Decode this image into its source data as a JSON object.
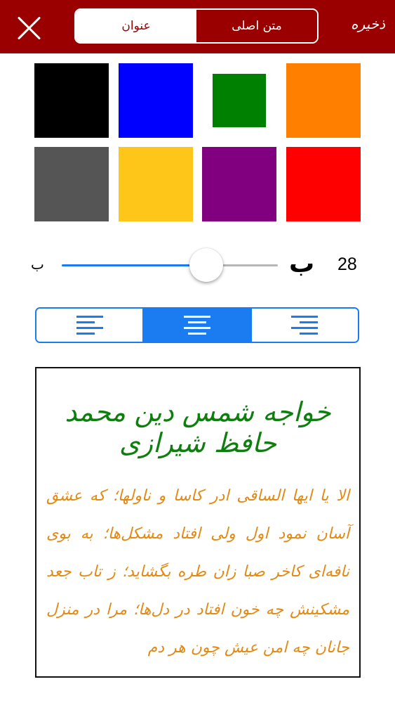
{
  "header": {
    "close_icon": "close-x-icon",
    "tabs": [
      {
        "label": "عنوان",
        "selected": true
      },
      {
        "label": "متن اصلی",
        "selected": false
      }
    ],
    "save_label": "ذخیره"
  },
  "colors": {
    "row1": [
      "#000000",
      "#0000ff",
      "#008000",
      "#ff8000"
    ],
    "row2": [
      "#555555",
      "#ffc61a",
      "#800080",
      "#ff0000"
    ],
    "selected": "#008000"
  },
  "font_size": {
    "small_label": "ب",
    "large_label": "ب",
    "value": "28",
    "slider_fraction": 0.67
  },
  "alignment": {
    "options": [
      "left",
      "center",
      "right"
    ],
    "selected": "center"
  },
  "preview": {
    "title": "خواجه شمس دین محمد حافظ شیرازی",
    "body": "الا یا ایها الساقی ادر کاسا و ناولها؛ که عشق آسان نمود اول ولی افتاد مشکل‌ها؛ به بوی نافه‌ای کاخر صبا زان طره بگشاید؛ ز تاب جعد مشکینش چه خون افتاد در دل‌ها؛ مرا در منزل جانان چه امن عیش چون هر دم"
  }
}
